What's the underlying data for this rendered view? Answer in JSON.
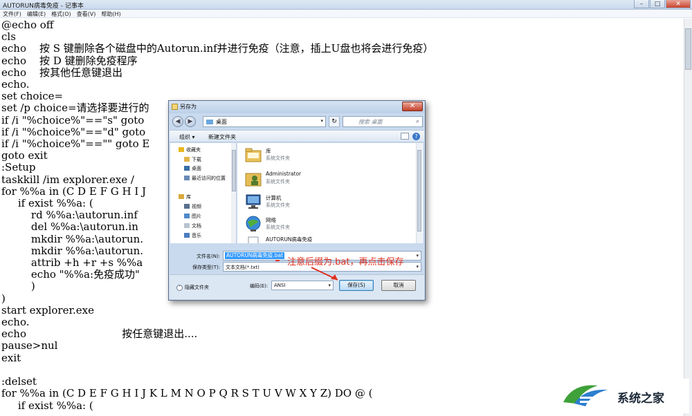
{
  "window": {
    "title": "AUTORUN病毒免疫 - 记事本",
    "controls": {
      "minimize": "–",
      "maximize": "□",
      "close": "✕"
    }
  },
  "menu": [
    "文件(F)",
    "编辑(E)",
    "格式(O)",
    "查看(V)",
    "帮助(H)"
  ],
  "editor_lines": [
    "@echo off",
    "cls",
    "echo    按 S 键删除各个磁盘中的Autorun.inf并进行免疫（注意，插上U盘也将会进行免疫）",
    "echo    按 D 键删除免疫程序",
    "echo    按其他任意键退出",
    "echo.",
    "set choice=",
    "set /p choice=请选择要进行的",
    "if /i \"%choice%\"==\"s\" goto",
    "if /i \"%choice%\"==\"d\" goto",
    "if /i \"%choice%\"==\"\" goto E",
    "goto exit",
    ":Setup",
    "taskkill /im explorer.exe /",
    "for %%a in (C D E F G H I J",
    "     if exist %%a: (",
    "         rd %%a:\\autorun.inf",
    "         del %%a:\\autorun.in",
    "         mkdir %%a:\\autorun.",
    "         mkdir %%a:\\autorun.",
    "         attrib +h +r +s %%a",
    "         echo \"%%a:免疫成功\"",
    "         )",
    ")",
    "start explorer.exe",
    "echo.",
    "echo                             按任意键退出....",
    "pause>nul",
    "exit",
    "",
    ":delset",
    "for %%a in (C D E F G H I J K L M N O P Q R S T U V W X Y Z) DO @ (",
    "     if exist %%a: ("
  ],
  "dialog": {
    "title": "另存为",
    "close": "✕",
    "address": "桌面",
    "search_placeholder": "搜索 桌面",
    "toolbar": {
      "organize": "组织 ▾",
      "new_folder": "新建文件夹",
      "help": "?"
    },
    "nav_items": [
      {
        "label": "收藏夹",
        "icon": "star-icon",
        "color": "#e8b820"
      },
      {
        "label": "下载",
        "icon": "download-folder-icon",
        "color": "#e1b549"
      },
      {
        "label": "桌面",
        "icon": "desktop-icon",
        "color": "#3a6ea5"
      },
      {
        "label": "最近访问的位置",
        "icon": "recent-places-icon",
        "color": "#6a8bb5"
      },
      {
        "label": "库",
        "icon": "library-icon",
        "color": "#d9a93a"
      },
      {
        "label": "视频",
        "icon": "video-icon",
        "color": "#5a6f8c"
      },
      {
        "label": "图片",
        "icon": "picture-icon",
        "color": "#4f8ac9"
      },
      {
        "label": "文档",
        "icon": "document-icon",
        "color": "#b8c2cf"
      },
      {
        "label": "音乐",
        "icon": "music-icon",
        "color": "#4a7cc0"
      }
    ],
    "files": [
      {
        "name": "库",
        "type": "系统文件夹",
        "icon": "library-folder-icon"
      },
      {
        "name": "Administrator",
        "type": "系统文件夹",
        "icon": "user-folder-icon"
      },
      {
        "name": "计算机",
        "type": "系统文件夹",
        "icon": "computer-icon"
      },
      {
        "name": "网络",
        "type": "系统文件夹",
        "icon": "network-icon"
      },
      {
        "name": "AUTORUN病毒免疫",
        "type": "",
        "icon": "text-file-icon"
      }
    ],
    "filename_label": "文件名(N):",
    "filename_value": "AUTORUN病毒免疫.bat",
    "filetype_label": "保存类型(T):",
    "filetype_value": "文本文档(*.txt)",
    "hide_folders": "隐藏文件夹",
    "encoding_label": "编码(E):",
    "encoding_value": "ANSI",
    "save_button": "保存(S)",
    "cancel_button": "取消"
  },
  "annotation": "注意后缀为.bat，再点击保存",
  "watermark": {
    "text": "系统之家"
  },
  "colors": {
    "annotation": "#e0301e",
    "selection": "#3399ff",
    "dialog_bg": "#c9daee"
  }
}
